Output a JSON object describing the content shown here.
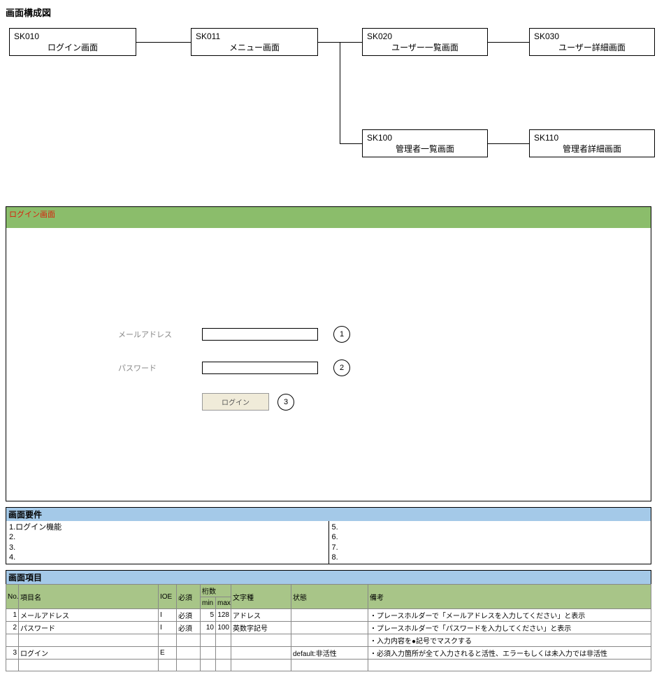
{
  "doc_title": "画面構成図",
  "flow": {
    "b1": {
      "id": "SK010",
      "name": "ログイン画面"
    },
    "b2": {
      "id": "SK011",
      "name": "メニュー画面"
    },
    "b3": {
      "id": "SK020",
      "name": "ユーザー一覧画面"
    },
    "b4": {
      "id": "SK030",
      "name": "ユーザー詳細画面"
    },
    "b5": {
      "id": "SK100",
      "name": "管理者一覧画面"
    },
    "b6": {
      "id": "SK110",
      "name": "管理者詳細画面"
    }
  },
  "mock": {
    "title": "ログイン画面",
    "email_label": "メールアドレス",
    "password_label": "パスワード",
    "login_button": "ログイン",
    "callout1": "1",
    "callout2": "2",
    "callout3": "3"
  },
  "requirements": {
    "header": "画面要件",
    "left": [
      "1.ログイン機能",
      "2.",
      "3.",
      "4."
    ],
    "right": [
      "5.",
      "6.",
      "7.",
      "8."
    ]
  },
  "items": {
    "header": "画面項目",
    "cols": {
      "no": "No.",
      "name": "項目名",
      "ioe": "IOE",
      "req": "必須",
      "digits": "桁数",
      "min": "min",
      "max": "max",
      "type": "文字種",
      "state": "状態",
      "note": "備考"
    },
    "rows": [
      {
        "no": "1",
        "name": "メールアドレス",
        "ioe": "I",
        "req": "必須",
        "min": "5",
        "max": "128",
        "type": "アドレス",
        "state": "",
        "note": "・プレースホルダーで「メールアドレスを入力してください」と表示"
      },
      {
        "no": "2",
        "name": "パスワード",
        "ioe": "I",
        "req": "必須",
        "min": "10",
        "max": "100",
        "type": "英数字記号",
        "state": "",
        "note": "・プレースホルダーで「パスワードを入力してください」と表示"
      },
      {
        "no": "",
        "name": "",
        "ioe": "",
        "req": "",
        "min": "",
        "max": "",
        "type": "",
        "state": "",
        "note": "・入力内容を●記号でマスクする"
      },
      {
        "no": "3",
        "name": "ログイン",
        "ioe": "E",
        "req": "",
        "min": "",
        "max": "",
        "type": "",
        "state": "default:非活性",
        "note": "・必須入力箇所が全て入力されると活性、エラーもしくは未入力では非活性"
      },
      {
        "no": "",
        "name": "",
        "ioe": "",
        "req": "",
        "min": "",
        "max": "",
        "type": "",
        "state": "",
        "note": ""
      }
    ]
  }
}
